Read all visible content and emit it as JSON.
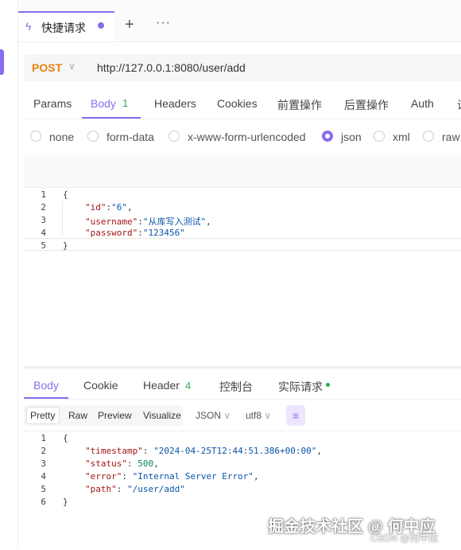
{
  "tab": {
    "title": "快捷请求"
  },
  "tabbar": {
    "plus": "+",
    "more": "···"
  },
  "request": {
    "method": "POST",
    "url": "http://127.0.0.1:8080/user/add"
  },
  "request_tabs": [
    "Params",
    "Body",
    "Headers",
    "Cookies",
    "前置操作",
    "后置操作",
    "Auth",
    "设"
  ],
  "body_count": "1",
  "body_types": [
    "none",
    "form-data",
    "x-www-form-urlencoded",
    "json",
    "xml",
    "raw"
  ],
  "selected_body_type": "json",
  "request_body": {
    "line_numbers": [
      "1",
      "2",
      "3",
      "4",
      "5"
    ],
    "open": "{",
    "close": "}",
    "fields": [
      {
        "key": "\"id\"",
        "value": "\"6\""
      },
      {
        "key": "\"username\"",
        "value": "\"从库写入测试\""
      },
      {
        "key": "\"password\"",
        "value": "\"123456\""
      }
    ]
  },
  "response_tabs": [
    "Body",
    "Cookie",
    "Header",
    "控制台",
    "实际请求"
  ],
  "header_count": "4",
  "format_options": [
    "Pretty",
    "Raw",
    "Preview",
    "Visualize"
  ],
  "selected_format": "Pretty",
  "content_type": "JSON",
  "encoding": "utf8",
  "response_body": {
    "line_numbers": [
      "1",
      "2",
      "3",
      "4",
      "5",
      "6"
    ],
    "open": "{",
    "close": "}",
    "fields": [
      {
        "key": "\"timestamp\"",
        "value": "\"2024-04-25T12:44:51.386+00:00\""
      },
      {
        "key": "\"status\"",
        "value": "500"
      },
      {
        "key": "\"error\"",
        "value": "\"Internal Server Error\""
      },
      {
        "key": "\"path\"",
        "value": "\"/user/add\""
      }
    ]
  },
  "watermark": {
    "main": "掘金技术社区 @ 何中应",
    "sub": "CSDN @何中应"
  },
  "colors": {
    "accent": "#8a6cf0",
    "method": "#e8840f",
    "count": "#2eaa5a"
  }
}
